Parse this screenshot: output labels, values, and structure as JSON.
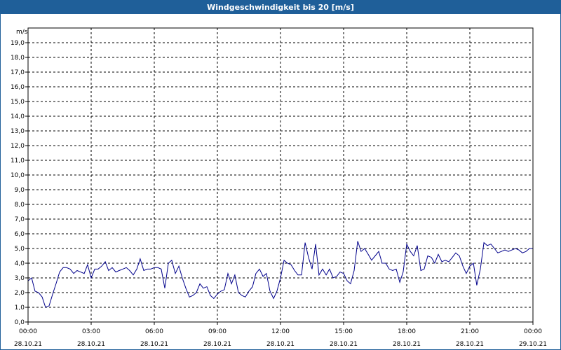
{
  "window": {
    "title": "Windgeschwindigkeit bis 20 [m/s]"
  },
  "chart_data": {
    "type": "line",
    "title": "Windgeschwindigkeit bis 20 [m/s]",
    "ylabel": "m/s",
    "ylim": [
      0,
      20
    ],
    "xlim_hours": [
      0,
      24
    ],
    "yticks": [
      "0,0",
      "1,0",
      "2,0",
      "3,0",
      "4,0",
      "5,0",
      "6,0",
      "7,0",
      "8,0",
      "9,0",
      "10,0",
      "11,0",
      "12,0",
      "13,0",
      "14,0",
      "15,0",
      "16,0",
      "17,0",
      "18,0",
      "19,0"
    ],
    "xticks": [
      {
        "time": "00:00",
        "date": "28.10.21"
      },
      {
        "time": "03:00",
        "date": "28.10.21"
      },
      {
        "time": "06:00",
        "date": "28.10.21"
      },
      {
        "time": "09:00",
        "date": "28.10.21"
      },
      {
        "time": "12:00",
        "date": "28.10.21"
      },
      {
        "time": "15:00",
        "date": "28.10.21"
      },
      {
        "time": "18:00",
        "date": "28.10.21"
      },
      {
        "time": "21:00",
        "date": "28.10.21"
      },
      {
        "time": "00:00",
        "date": "29.10.21"
      }
    ],
    "grid": true,
    "line_color": "#00008b",
    "series": [
      {
        "x": [
          0,
          0.17,
          0.33,
          0.5,
          0.67,
          0.83,
          1,
          1.17,
          1.33,
          1.5,
          1.67,
          1.83,
          2,
          2.17,
          2.33,
          2.5,
          2.67,
          2.83,
          3,
          3.17,
          3.33,
          3.5,
          3.67,
          3.83,
          4,
          4.17,
          4.33,
          4.5,
          4.67,
          4.83,
          5,
          5.17,
          5.33,
          5.5,
          5.67,
          5.83,
          6,
          6.17,
          6.33,
          6.5,
          6.67,
          6.83,
          7,
          7.17,
          7.33,
          7.5,
          7.67,
          7.83,
          8,
          8.17,
          8.33,
          8.5,
          8.67,
          8.83,
          9,
          9.17,
          9.33,
          9.5,
          9.67,
          9.83,
          10,
          10.17,
          10.33,
          10.5,
          10.67,
          10.83,
          11,
          11.17,
          11.33,
          11.5,
          11.67,
          11.83,
          12,
          12.17,
          12.33,
          12.5,
          12.67,
          12.83,
          13,
          13.17,
          13.33,
          13.5,
          13.67,
          13.83,
          14,
          14.17,
          14.33,
          14.5,
          14.67,
          14.83,
          15,
          15.17,
          15.33,
          15.5,
          15.67,
          15.83,
          16,
          16.17,
          16.33,
          16.5,
          16.67,
          16.83,
          17,
          17.17,
          17.33,
          17.5,
          17.67,
          17.83,
          18,
          18.17,
          18.33,
          18.5,
          18.67,
          18.83,
          19,
          19.17,
          19.33,
          19.5,
          19.67,
          19.83,
          20,
          20.17,
          20.33,
          20.5,
          20.67,
          20.83,
          21,
          21.17,
          21.33,
          21.5,
          21.67,
          21.83,
          22,
          22.17,
          22.33,
          22.5,
          22.67,
          22.83,
          23,
          23.17,
          23.33,
          23.5,
          23.67,
          23.83,
          24
        ],
        "y": [
          2.8,
          3.0,
          2.1,
          2.0,
          1.7,
          1.0,
          1.1,
          1.9,
          2.6,
          3.4,
          3.7,
          3.7,
          3.6,
          3.3,
          3.5,
          3.4,
          3.3,
          3.9,
          3.0,
          3.6,
          3.6,
          3.8,
          4.1,
          3.5,
          3.7,
          3.4,
          3.5,
          3.6,
          3.7,
          3.5,
          3.2,
          3.6,
          4.3,
          3.5,
          3.6,
          3.6,
          3.7,
          3.7,
          3.6,
          2.3,
          4.0,
          4.2,
          3.3,
          3.8,
          3.0,
          2.3,
          1.7,
          1.8,
          2.0,
          2.6,
          2.3,
          2.4,
          1.8,
          1.6,
          1.9,
          2.1,
          2.2,
          3.3,
          2.6,
          3.2,
          2.0,
          1.8,
          1.7,
          2.1,
          2.4,
          3.3,
          3.6,
          3.1,
          3.3,
          2.1,
          1.6,
          2.1,
          3.0,
          4.2,
          4.0,
          3.9,
          3.5,
          3.2,
          3.2,
          5.4,
          4.4,
          3.6,
          5.3,
          3.2,
          3.6,
          3.2,
          3.6,
          3.0,
          3.1,
          3.4,
          3.3,
          2.8,
          2.6,
          3.5,
          5.5,
          4.8,
          5.0,
          4.6,
          4.2,
          4.5,
          4.8,
          4.0,
          4.0,
          3.6,
          3.5,
          3.6,
          2.7,
          3.4,
          5.3,
          4.8,
          4.5,
          5.2,
          3.5,
          3.6,
          4.5,
          4.4,
          4.0,
          4.6,
          4.1,
          4.2,
          4.1,
          4.4,
          4.7,
          4.5,
          3.8,
          3.3,
          3.8,
          4.0,
          2.5,
          3.6,
          5.4,
          5.2,
          5.3,
          5.0,
          4.7,
          4.8,
          4.9,
          4.8,
          4.9,
          5.0,
          4.9,
          4.7,
          4.8,
          5.0,
          5.0
        ]
      }
    ]
  }
}
